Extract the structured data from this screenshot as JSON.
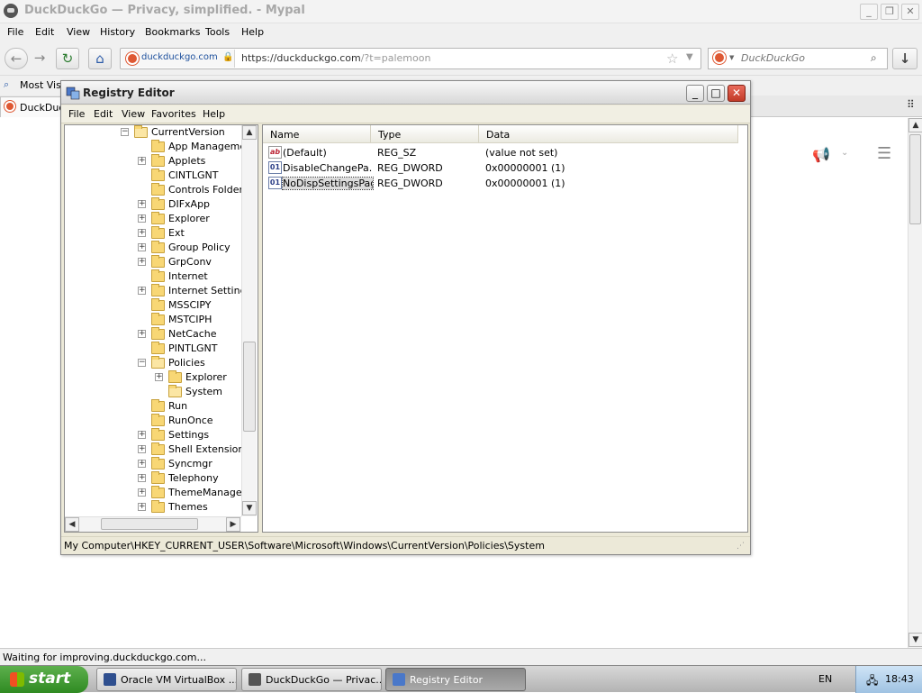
{
  "browser": {
    "title": "DuckDuckGo — Privacy, simplified. - Mypal",
    "window_buttons": {
      "minimize": "_",
      "maximize": "❐",
      "close": "✕"
    },
    "menu": [
      "File",
      "Edit",
      "View",
      "History",
      "Bookmarks",
      "Tools",
      "Help"
    ],
    "nav": {
      "back": "←",
      "forward": "→",
      "reload": "↻",
      "home": "⌂",
      "download": "↓"
    },
    "site_identity": "duckduckgo.com",
    "url_prefix": "https://duckduckgo.com",
    "url_suffix": "/?t=palemoon",
    "search_placeholder": "DuckDuckGo",
    "bookmark_label": "Most Visi",
    "tab_label": "DuckDuc",
    "status": "Waiting for improving.duckduckgo.com..."
  },
  "regedit": {
    "title": "Registry Editor",
    "window_buttons": {
      "minimize": "_",
      "maximize": "□",
      "close": "✕"
    },
    "menu": [
      "File",
      "Edit",
      "View",
      "Favorites",
      "Help"
    ],
    "tree": [
      {
        "label": "CurrentVersion",
        "indent": 0,
        "expander": "−",
        "open": true
      },
      {
        "label": "App Managemer",
        "indent": 1,
        "expander": ""
      },
      {
        "label": "Applets",
        "indent": 1,
        "expander": "+"
      },
      {
        "label": "CINTLGNT",
        "indent": 1,
        "expander": ""
      },
      {
        "label": "Controls Folder",
        "indent": 1,
        "expander": ""
      },
      {
        "label": "DIFxApp",
        "indent": 1,
        "expander": "+"
      },
      {
        "label": "Explorer",
        "indent": 1,
        "expander": "+"
      },
      {
        "label": "Ext",
        "indent": 1,
        "expander": "+"
      },
      {
        "label": "Group Policy",
        "indent": 1,
        "expander": "+"
      },
      {
        "label": "GrpConv",
        "indent": 1,
        "expander": "+"
      },
      {
        "label": "Internet",
        "indent": 1,
        "expander": ""
      },
      {
        "label": "Internet Settings",
        "indent": 1,
        "expander": "+"
      },
      {
        "label": "MSSCIPY",
        "indent": 1,
        "expander": ""
      },
      {
        "label": "MSTCIPH",
        "indent": 1,
        "expander": ""
      },
      {
        "label": "NetCache",
        "indent": 1,
        "expander": "+"
      },
      {
        "label": "PINTLGNT",
        "indent": 1,
        "expander": ""
      },
      {
        "label": "Policies",
        "indent": 1,
        "expander": "−",
        "open": true
      },
      {
        "label": "Explorer",
        "indent": 2,
        "expander": "+"
      },
      {
        "label": "System",
        "indent": 2,
        "expander": "",
        "open": true
      },
      {
        "label": "Run",
        "indent": 1,
        "expander": ""
      },
      {
        "label": "RunOnce",
        "indent": 1,
        "expander": ""
      },
      {
        "label": "Settings",
        "indent": 1,
        "expander": "+"
      },
      {
        "label": "Shell Extensions",
        "indent": 1,
        "expander": "+"
      },
      {
        "label": "Syncmgr",
        "indent": 1,
        "expander": "+"
      },
      {
        "label": "Telephony",
        "indent": 1,
        "expander": "+"
      },
      {
        "label": "ThemeManager",
        "indent": 1,
        "expander": "+"
      },
      {
        "label": "Themes",
        "indent": 1,
        "expander": "+"
      }
    ],
    "columns": [
      "Name",
      "Type",
      "Data"
    ],
    "values": [
      {
        "icon": "ab",
        "name": "(Default)",
        "type": "REG_SZ",
        "data": "(value not set)"
      },
      {
        "icon": "01",
        "name": "DisableChangePa...",
        "type": "REG_DWORD",
        "data": "0x00000001 (1)"
      },
      {
        "icon": "01",
        "name": "NoDispSettingsPage",
        "type": "REG_DWORD",
        "data": "0x00000001 (1)",
        "selected": true
      }
    ],
    "status_path": "My Computer\\HKEY_CURRENT_USER\\Software\\Microsoft\\Windows\\CurrentVersion\\Policies\\System"
  },
  "taskbar": {
    "start_label": "start",
    "items": [
      {
        "label": "Oracle VM VirtualBox ...",
        "icon_color": "#2f4f8f"
      },
      {
        "label": "DuckDuckGo — Privac...",
        "icon_color": "#555555"
      },
      {
        "label": "Registry Editor",
        "icon_color": "#4a78c9",
        "active": true
      }
    ],
    "language": "EN",
    "clock": "18:43"
  },
  "colors": {
    "ddg_orange": "#de5833",
    "start_green": "#3c9a2c",
    "close_red": "#c84a39"
  }
}
